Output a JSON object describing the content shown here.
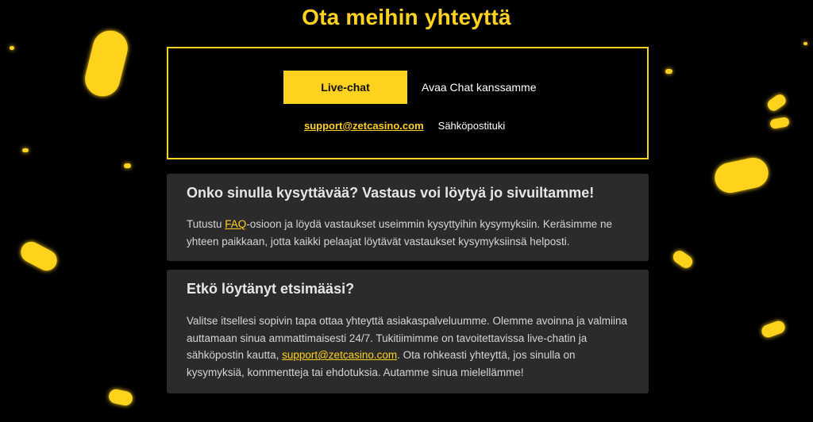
{
  "page": {
    "title": "Ota meihin yhteyttä"
  },
  "contact": {
    "live_chat_button": "Live-chat",
    "live_chat_description": "Avaa Chat kanssamme",
    "email_link": "support@zetcasino.com",
    "email_description": "Sähköpostituki"
  },
  "faq_card": {
    "heading": "Onko sinulla kysyttävää? Vastaus voi löytyä jo sivuiltamme!",
    "text_before_link": "Tutustu ",
    "link_text": "FAQ",
    "text_after_link": "-osioon ja löydä vastaukset useimmin kysyttyihin kysymyksiin. Keräsimme ne yhteen paikkaan, jotta kaikki pelaajat löytävät vastaukset kysymyksiinsä helposti."
  },
  "help_card": {
    "heading": "Etkö löytänyt etsimääsi?",
    "text_before_link": "Valitse itsellesi sopivin tapa ottaa yhteyttä asiakaspalveluumme. Olemme avoinna ja valmiina auttamaan sinua ammattimaisesti 24/7. Tukitiimimme on tavoitettavissa live-chatin ja sähköpostin kautta, ",
    "link_text": "support@zetcasino.com",
    "text_after_link": ". Ota rohkeasti yhteyttä, jos sinulla on kysymyksiä, kommentteja tai ehdotuksia. Autamme sinua mielellämme!"
  },
  "colors": {
    "accent": "#ffd21f",
    "background": "#000000",
    "card": "#2b2b2b"
  },
  "decorations": {
    "icon": "coin-icon"
  }
}
